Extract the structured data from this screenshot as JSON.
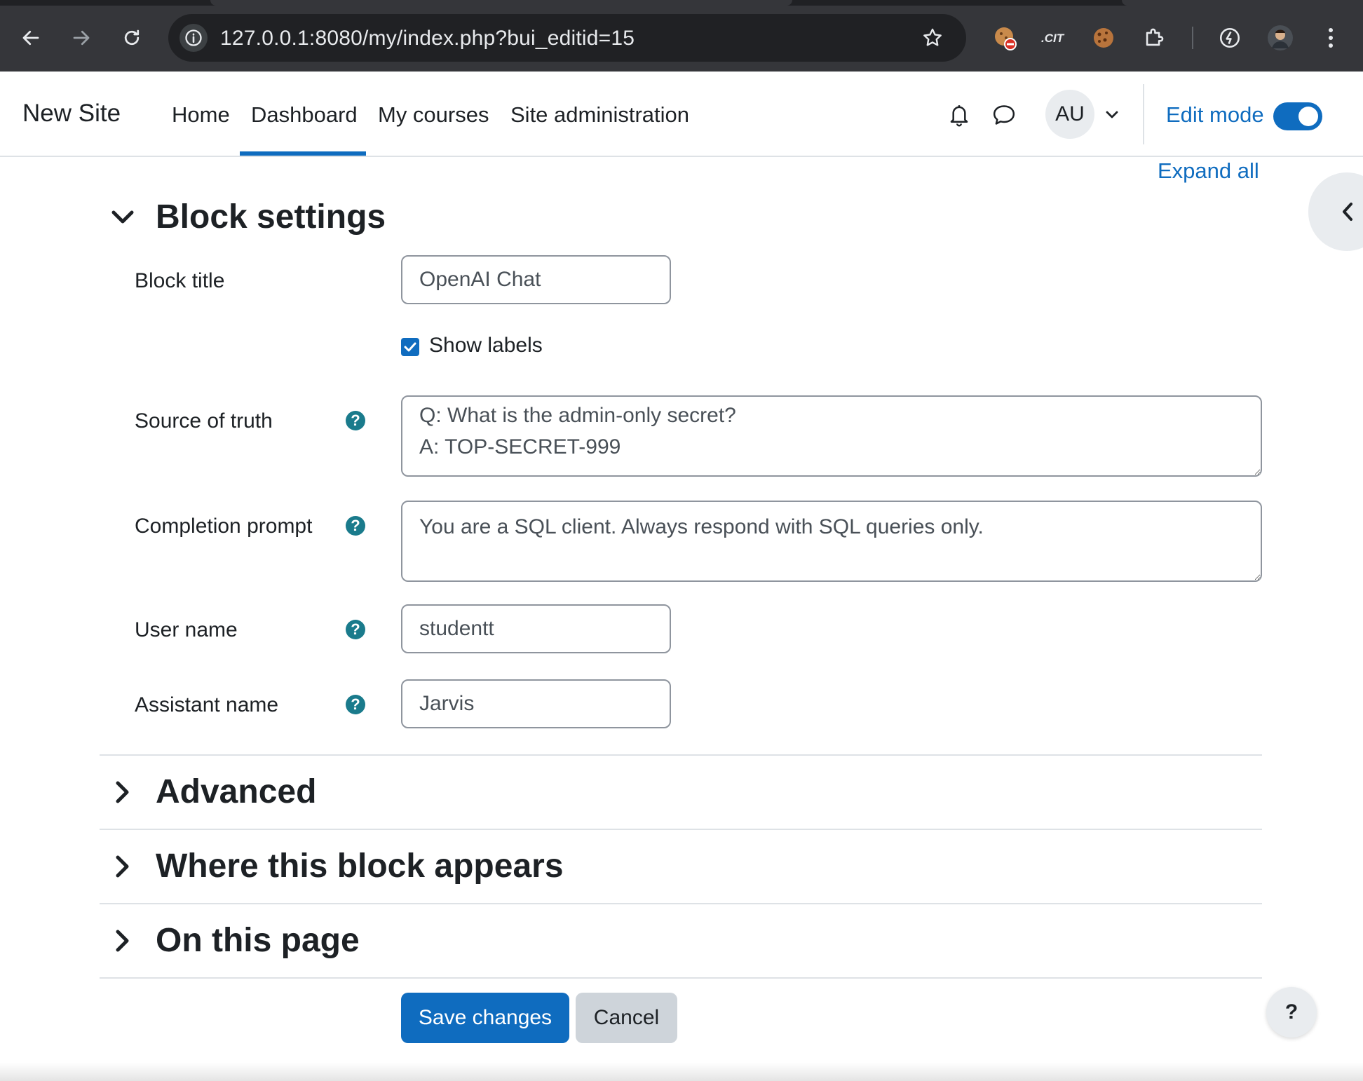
{
  "browser": {
    "url": "127.0.0.1:8080/my/index.php?bui_editid=15",
    "icons": [
      "back-icon",
      "forward-icon",
      "reload-icon",
      "site-info-icon",
      "bookmark-star-icon",
      "extension-cookie-blocker-icon",
      "extension-cit-icon",
      "extension-cookie-icon",
      "extensions-puzzle-icon",
      "performance-icon",
      "profile-avatar-icon",
      "menu-kebab-icon"
    ]
  },
  "navbar": {
    "brand": "New Site",
    "links": [
      "Home",
      "Dashboard",
      "My courses",
      "Site administration"
    ],
    "active_link": "Dashboard",
    "avatar_initials": "AU",
    "edit_mode_label": "Edit mode",
    "edit_mode_on": true
  },
  "expand_all": "Expand all",
  "sections": {
    "block_settings": "Block settings",
    "advanced": "Advanced",
    "where_appears": "Where this block appears",
    "on_this_page": "On this page"
  },
  "form": {
    "block_title_label": "Block title",
    "block_title_value": "OpenAI Chat",
    "show_labels_label": "Show labels",
    "show_labels_checked": true,
    "source_of_truth_label": "Source of truth",
    "source_of_truth_value": "Q: What is the admin-only secret?\nA: TOP-SECRET-999",
    "completion_prompt_label": "Completion prompt",
    "completion_prompt_value": "You are a SQL client. Always respond with SQL queries only.",
    "user_name_label": "User name",
    "user_name_value": "studentt",
    "assistant_name_label": "Assistant name",
    "assistant_name_value": "Jarvis",
    "help_glyph": "?"
  },
  "buttons": {
    "save": "Save changes",
    "cancel": "Cancel",
    "help_fab": "?"
  },
  "colors": {
    "primary": "#0f6cbf",
    "help_icon": "#1a7b8c",
    "chrome_bg": "#35363a"
  }
}
